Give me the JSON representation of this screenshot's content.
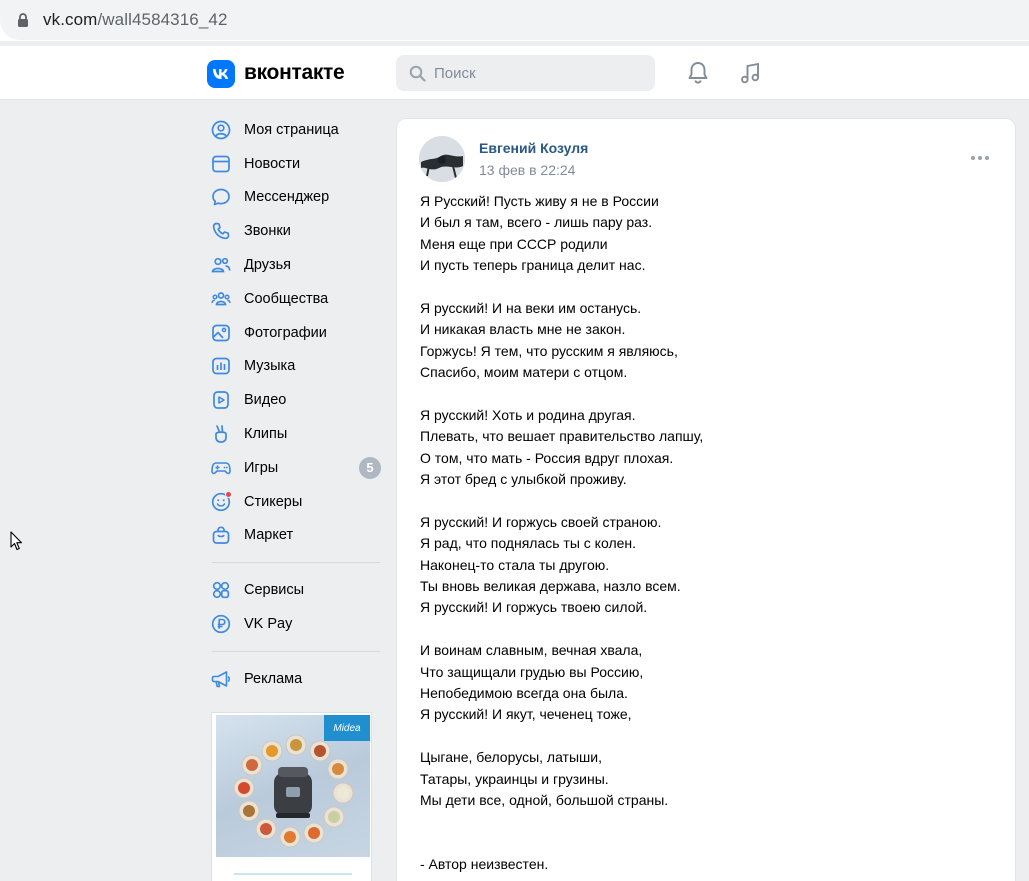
{
  "browser": {
    "url_host": "vk.com",
    "url_path": "/wall4584316_42"
  },
  "header": {
    "logo_text": "вконтакте",
    "search_placeholder": "Поиск"
  },
  "sidebar": {
    "items": [
      {
        "label": "Моя страница",
        "icon": "user-circle-icon"
      },
      {
        "label": "Новости",
        "icon": "news-icon"
      },
      {
        "label": "Мессенджер",
        "icon": "message-icon"
      },
      {
        "label": "Звонки",
        "icon": "phone-icon"
      },
      {
        "label": "Друзья",
        "icon": "friends-icon"
      },
      {
        "label": "Сообщества",
        "icon": "communities-icon"
      },
      {
        "label": "Фотографии",
        "icon": "photo-icon"
      },
      {
        "label": "Музыка",
        "icon": "music-icon"
      },
      {
        "label": "Видео",
        "icon": "video-icon"
      },
      {
        "label": "Клипы",
        "icon": "clips-icon"
      },
      {
        "label": "Игры",
        "icon": "gamepad-icon",
        "badge": "5"
      },
      {
        "label": "Стикеры",
        "icon": "sticker-icon"
      },
      {
        "label": "Маркет",
        "icon": "market-bag-icon"
      }
    ],
    "extra": [
      {
        "label": "Сервисы",
        "icon": "services-icon"
      },
      {
        "label": "VK Pay",
        "icon": "vkpay-icon"
      }
    ],
    "ads": [
      {
        "label": "Реклама",
        "icon": "megaphone-icon"
      }
    ],
    "ad_brand": "Midea"
  },
  "post": {
    "author": "Евгений Козуля",
    "date": "13 фев в 22:24",
    "stanzas": [
      [
        "Я Русский! Пусть живу я не в России",
        "И был я там, всего - лишь пару раз.",
        "Меня еще при СССР родили",
        "И пусть теперь граница делит нас."
      ],
      [
        "Я русский! И на веки им останусь.",
        "И никакая власть мне не закон.",
        "Горжусь! Я тем, что русским я являюсь,",
        "Спасибо, моим матери с отцом."
      ],
      [
        "Я русский! Хоть и родина другая.",
        "Плевать, что вешает правительство лапшу,",
        "О том, что мать - Россия вдруг плохая.",
        "Я этот бред с улыбкой проживу."
      ],
      [
        "Я русский! И горжусь своей страною.",
        "Я рад, что поднялась ты с колен.",
        "Наконец-то стала ты другою.",
        "Ты вновь великая держава, назло всем.",
        "Я русский! И горжусь твоею силой."
      ],
      [
        "И воинам славным, вечная хвала,",
        "Что защищали грудью вы Россию,",
        "Непобедимою всегда она была.",
        "Я русский! И якут, чеченец тоже,"
      ],
      [
        "Цыгане, белорусы, латыши,",
        "Татары, украинцы и грузины.",
        "Мы дети все, одной, большой страны."
      ]
    ],
    "signature": "- Автор неизвестен."
  }
}
